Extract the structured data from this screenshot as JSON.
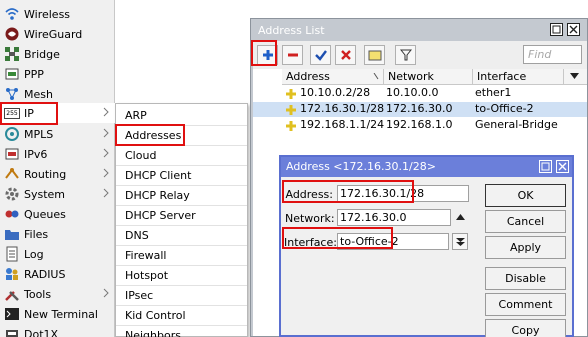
{
  "sidebar": {
    "items": [
      {
        "label": "Wireless",
        "icon": "wireless-icon"
      },
      {
        "label": "WireGuard",
        "icon": "wireguard-icon"
      },
      {
        "label": "Bridge",
        "icon": "bridge-icon"
      },
      {
        "label": "PPP",
        "icon": "ppp-icon"
      },
      {
        "label": "Mesh",
        "icon": "mesh-icon"
      },
      {
        "label": "IP",
        "icon": "ip-icon"
      },
      {
        "label": "MPLS",
        "icon": "mpls-icon"
      },
      {
        "label": "IPv6",
        "icon": "ipv6-icon"
      },
      {
        "label": "Routing",
        "icon": "routing-icon"
      },
      {
        "label": "System",
        "icon": "system-icon"
      },
      {
        "label": "Queues",
        "icon": "queues-icon"
      },
      {
        "label": "Files",
        "icon": "files-icon"
      },
      {
        "label": "Log",
        "icon": "log-icon"
      },
      {
        "label": "RADIUS",
        "icon": "radius-icon"
      },
      {
        "label": "Tools",
        "icon": "tools-icon"
      },
      {
        "label": "New Terminal",
        "icon": "terminal-icon"
      },
      {
        "label": "Dot1X",
        "icon": "dot1x-icon"
      }
    ],
    "ip_icon_text": "255"
  },
  "submenu": {
    "items": [
      "ARP",
      "Addresses",
      "Cloud",
      "DHCP Client",
      "DHCP Relay",
      "DHCP Server",
      "DNS",
      "Firewall",
      "Hotspot",
      "IPsec",
      "Kid Control",
      "Neighbors"
    ]
  },
  "address_list": {
    "title": "Address List",
    "find_placeholder": "Find",
    "columns": [
      "Address",
      "Network",
      "Interface"
    ],
    "rows": [
      {
        "address": "10.10.0.2/28",
        "network": "10.10.0.0",
        "interface": "ether1"
      },
      {
        "address": "172.16.30.1/28",
        "network": "172.16.30.0",
        "interface": "to-Office-2"
      },
      {
        "address": "192.168.1.1/24",
        "network": "192.168.1.0",
        "interface": "General-Bridge"
      }
    ]
  },
  "dialog": {
    "title": "Address <172.16.30.1/28>",
    "address_label": "Address:",
    "address_value": "172.16.30.1/28",
    "network_label": "Network:",
    "network_value": "172.16.30.0",
    "interface_label": "Interface:",
    "interface_value": "to-Office-2",
    "buttons": {
      "ok": "OK",
      "cancel": "Cancel",
      "apply": "Apply",
      "disable": "Disable",
      "comment": "Comment",
      "copy": "Copy"
    }
  },
  "colors": {
    "highlight_red": "#e01010",
    "dialog_title": "#6b7fda",
    "selected_row": "#cfe0f4",
    "add_blue": "#1e5fc8",
    "remove_red": "#d02020"
  }
}
